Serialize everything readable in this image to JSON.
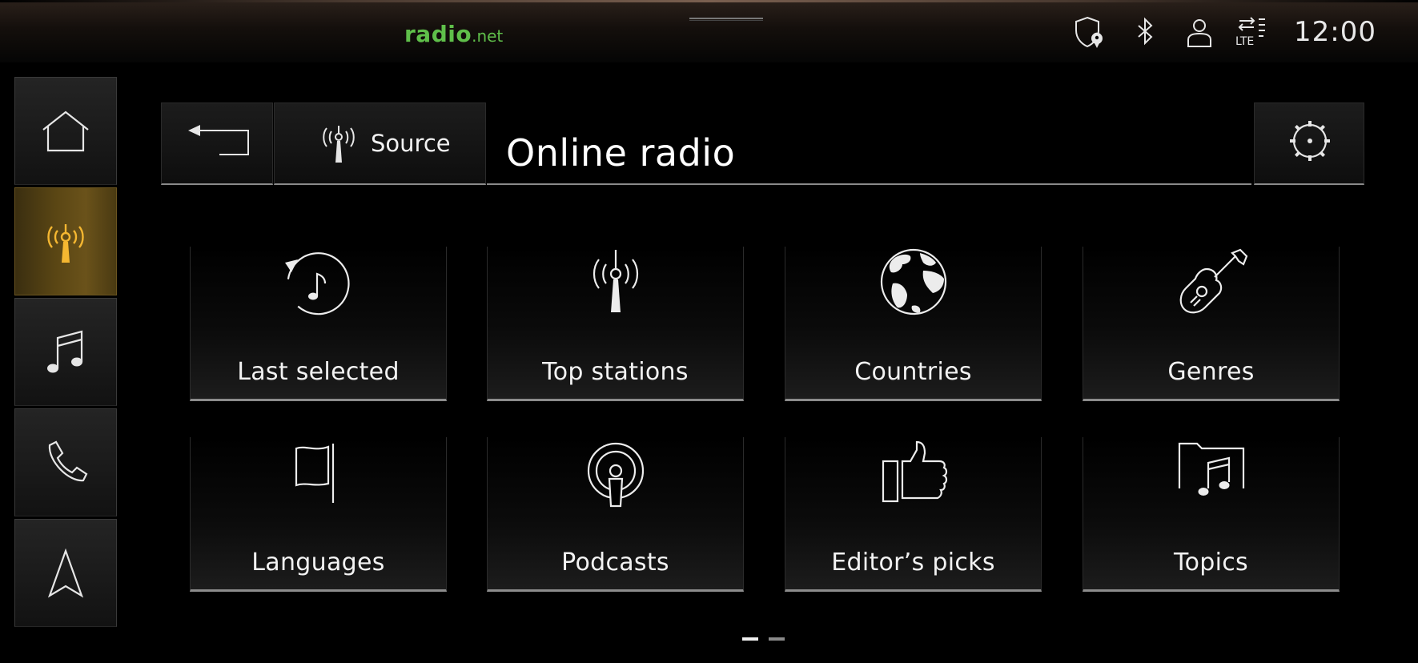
{
  "status_bar": {
    "logo_main": "radio",
    "logo_suffix": ".net",
    "time": "12:00",
    "network_label": "LTE",
    "icons": [
      "shield-location-icon",
      "bluetooth-icon",
      "user-profile-icon",
      "lte-signal-icon"
    ]
  },
  "sidebar": {
    "items": [
      {
        "name": "home",
        "icon": "home-icon",
        "active": false
      },
      {
        "name": "radio",
        "icon": "radio-antenna-icon",
        "active": true
      },
      {
        "name": "media",
        "icon": "music-note-icon",
        "active": false
      },
      {
        "name": "phone",
        "icon": "phone-icon",
        "active": false
      },
      {
        "name": "navigation",
        "icon": "navigation-arrow-icon",
        "active": false
      }
    ]
  },
  "header": {
    "back_icon": "back-arrow-icon",
    "source_label": "Source",
    "source_icon": "radio-antenna-icon",
    "title": "Online radio",
    "settings_icon": "gear-icon"
  },
  "tiles": [
    {
      "label": "Last selected",
      "icon": "recent-music-icon"
    },
    {
      "label": "Top stations",
      "icon": "radio-tower-icon"
    },
    {
      "label": "Countries",
      "icon": "globe-icon"
    },
    {
      "label": "Genres",
      "icon": "guitar-icon"
    },
    {
      "label": "Languages",
      "icon": "flag-icon"
    },
    {
      "label": "Podcasts",
      "icon": "podcast-icon"
    },
    {
      "label": "Editor’s picks",
      "icon": "thumbs-up-icon"
    },
    {
      "label": "Topics",
      "icon": "music-folder-icon"
    }
  ],
  "pager": {
    "total_pages": 2,
    "current_page": 1
  },
  "colors": {
    "accent": "#f5b731",
    "active_bg": "#5a4614",
    "logo_green": "#5fbf4a",
    "text": "#f2f2f2",
    "background": "#000000"
  }
}
